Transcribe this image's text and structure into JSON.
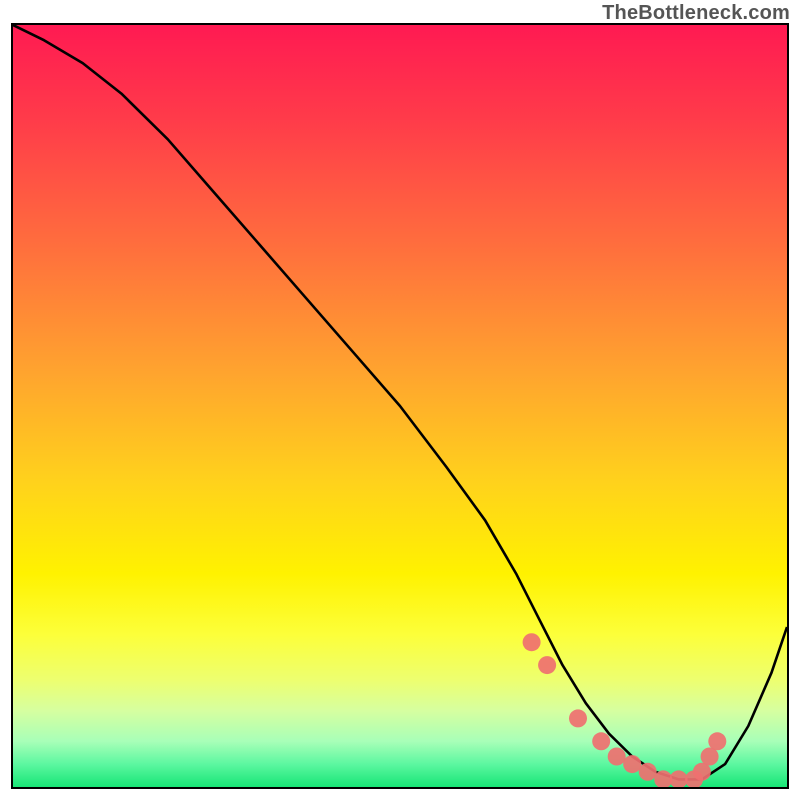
{
  "attribution": "TheBottleneck.com",
  "colors": {
    "frame": "#000000",
    "curve": "#000000",
    "dot_fill": "#ef7070",
    "gradient_top": "#ff1a52",
    "gradient_bottom": "#18e576"
  },
  "chart_data": {
    "type": "line",
    "title": "",
    "xlabel": "",
    "ylabel": "",
    "xlim": [
      0,
      100
    ],
    "ylim": [
      0,
      100
    ],
    "axes_hidden": true,
    "background": "vertical heat gradient (red top → yellow → green bottom)",
    "series": [
      {
        "name": "bottleneck-curve",
        "x": [
          0,
          4,
          9,
          14,
          20,
          26,
          32,
          38,
          44,
          50,
          56,
          61,
          65,
          68,
          71,
          74,
          77,
          80,
          83,
          86,
          89,
          92,
          95,
          98,
          100
        ],
        "y": [
          100,
          98,
          95,
          91,
          85,
          78,
          71,
          64,
          57,
          50,
          42,
          35,
          28,
          22,
          16,
          11,
          7,
          4,
          2,
          1,
          1,
          3,
          8,
          15,
          21
        ]
      }
    ],
    "markers": [
      {
        "name": "highlight-dots",
        "color": "#ef7070",
        "x": [
          67,
          69,
          73,
          76,
          78,
          80,
          82,
          84,
          86,
          88,
          89,
          90,
          91
        ],
        "y": [
          19,
          16,
          9,
          6,
          4,
          3,
          2,
          1,
          1,
          1,
          2,
          4,
          6
        ]
      }
    ]
  }
}
